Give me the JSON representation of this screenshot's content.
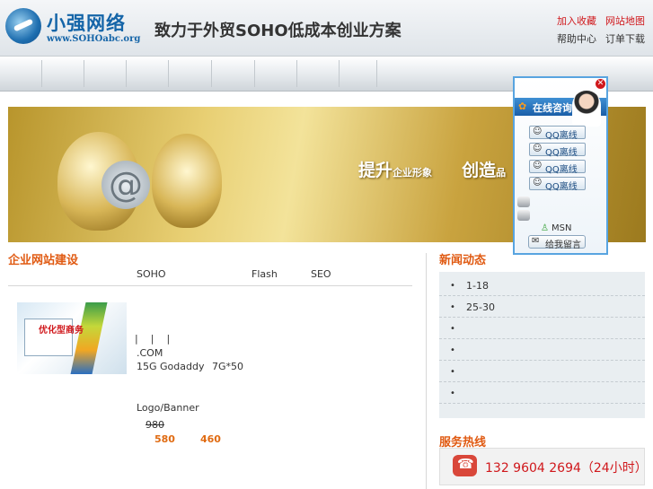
{
  "header": {
    "logo_text": "小强网络",
    "logo_url": "www.SOHOabc.org",
    "slogan": "致力于外贸SOHO低成本创业方案",
    "links_red": [
      "加入收藏",
      "网站地图"
    ],
    "links_dark": [
      "帮助中心",
      "订单下载"
    ]
  },
  "banner": {
    "text_big1": "提升",
    "text_small1": "企业形象",
    "text_big2": "创造",
    "text_small2": "品"
  },
  "left_section": {
    "title": "企业网站建设",
    "tags": [
      "SOHO",
      "Flash",
      "SEO"
    ],
    "thumb_label": "优化型商务",
    "pipes": [
      "|",
      "|",
      "|"
    ],
    "line_com": ".COM",
    "line_space": "15G Godaddy",
    "line_space2": "7G*50",
    "line_logo": "Logo/Banner",
    "price_old": "980",
    "price_a": "580",
    "price_b": "460"
  },
  "news": {
    "title": "新闻动态",
    "bullet": "•",
    "items": [
      "1-18",
      "25-30",
      "",
      "",
      "",
      ""
    ]
  },
  "hotline": {
    "title": "服务热线",
    "number": "132 9604 2694（24小时）"
  },
  "qq_panel": {
    "close": "✕",
    "header_icon": "✿",
    "title": "在线咨询",
    "buttons": [
      "QQ离线",
      "QQ离线",
      "QQ离线",
      "QQ离线"
    ],
    "button_icon": "penguin-icon",
    "msn_label": "MSN",
    "leave_message": "给我留言"
  }
}
